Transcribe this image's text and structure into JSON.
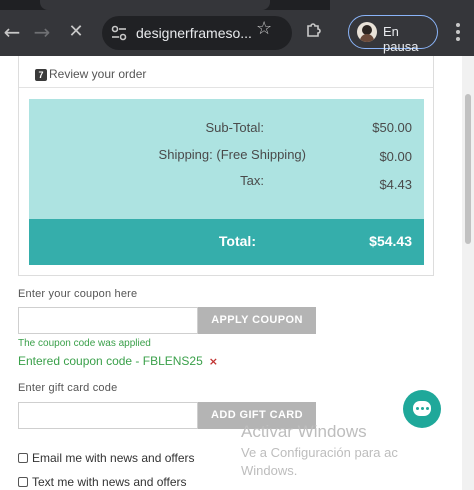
{
  "browser": {
    "url": "designerframeso...",
    "profile_label": "En pausa"
  },
  "review": {
    "step_number": "7",
    "title": "Review your order",
    "subtotal_label": "Sub-Total:",
    "subtotal_value": "$50.00",
    "shipping_label": "Shipping:",
    "shipping_method": "(Free Shipping)",
    "shipping_value": "$0.00",
    "tax_label": "Tax:",
    "tax_value": "$4.43",
    "total_label": "Total:",
    "total_value": "$54.43"
  },
  "coupon": {
    "label": "Enter your coupon here",
    "input_value": "",
    "button": "APPLY COUPON",
    "applied_message": "The coupon code was applied",
    "entered_text": "Entered coupon code - FBLENS25",
    "remove_symbol": "×"
  },
  "gift_card": {
    "label": "Enter gift card code",
    "input_value": "",
    "button": "ADD GIFT CARD"
  },
  "checkboxes": [
    {
      "label": "Email me with news and offers",
      "checked": false
    },
    {
      "label": "Text me with news and offers",
      "checked": false
    }
  ],
  "watermark": {
    "title": "Activar Windows",
    "subtitle_1": "Ve a Configuración para ac",
    "subtitle_2": "Windows."
  },
  "colors": {
    "summary_bg": "#ade3e1",
    "total_bg": "#35aeab",
    "button_grey": "#b4b4b4",
    "success_green": "#3aa04a",
    "chat_teal": "#1fa89a"
  }
}
